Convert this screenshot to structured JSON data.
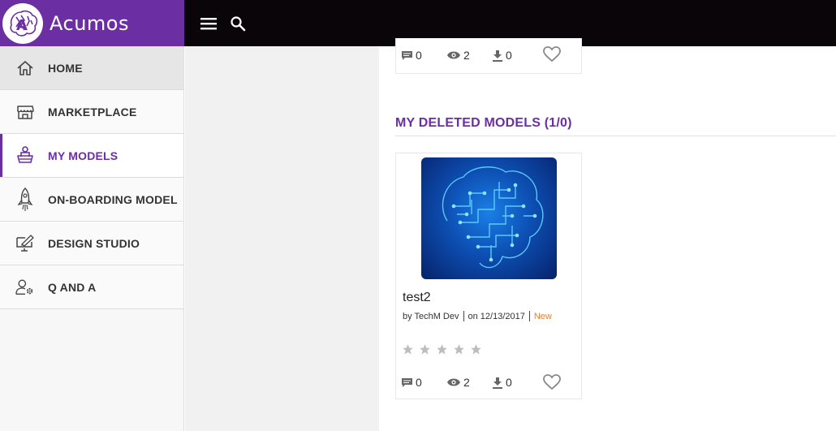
{
  "brand": {
    "name": "Acumos"
  },
  "topbar": {
    "menu_icon": "hamburger-menu-icon",
    "search_icon": "search-icon"
  },
  "sidebar": {
    "items": [
      {
        "label": "HOME",
        "icon": "home-icon"
      },
      {
        "label": "MARKETPLACE",
        "icon": "storefront-icon"
      },
      {
        "label": "MY MODELS",
        "icon": "my-models-icon"
      },
      {
        "label": "ON-BOARDING MODEL",
        "icon": "rocket-icon"
      },
      {
        "label": "DESIGN STUDIO",
        "icon": "design-studio-icon"
      },
      {
        "label": "Q AND A",
        "icon": "user-settings-icon"
      }
    ],
    "active_index": 2
  },
  "top_card": {
    "comments": "0",
    "views": "2",
    "downloads": "0"
  },
  "section": {
    "title": "MY DELETED MODELS (1/0)"
  },
  "deleted_card": {
    "name": "test2",
    "author": "by TechM Dev",
    "date": "on 12/13/2017",
    "badge": "New",
    "comments": "0",
    "views": "2",
    "downloads": "0",
    "rating": 0,
    "rating_max": 5
  },
  "colors": {
    "brand": "#6c2ea3",
    "topbar": "#0a0509",
    "badge": "#f07b2b"
  }
}
